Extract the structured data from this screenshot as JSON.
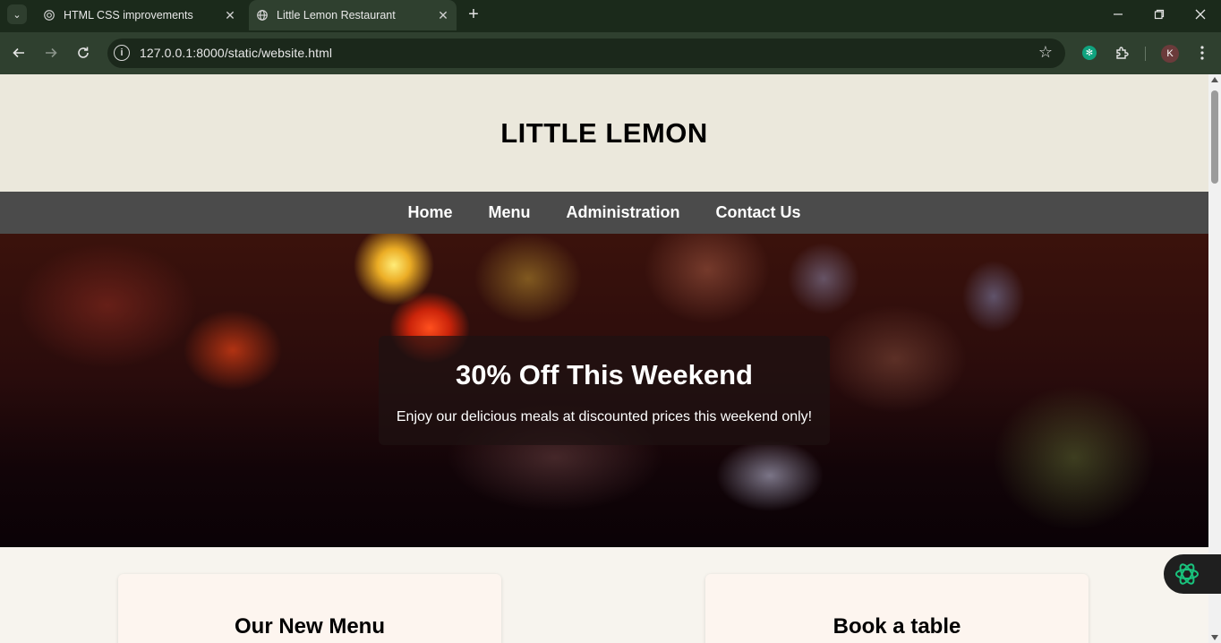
{
  "browser": {
    "tabs": [
      {
        "title": "HTML CSS improvements",
        "icon": "chatgpt-icon",
        "active": false
      },
      {
        "title": "Little Lemon Restaurant",
        "icon": "globe-icon",
        "active": true
      }
    ],
    "url": "127.0.0.1:8000/static/website.html",
    "profile_initial": "K",
    "colors": {
      "frame": "#1b2a1b",
      "toolbar": "#2f402f"
    }
  },
  "site": {
    "title": "LITTLE LEMON",
    "nav": [
      "Home",
      "Menu",
      "Administration",
      "Contact Us"
    ],
    "promo": {
      "heading": "30% Off This Weekend",
      "text": "Enjoy our delicious meals at discounted prices this weekend only!"
    },
    "cards": [
      "Our New Menu",
      "Book a table"
    ],
    "colors": {
      "header_bg": "#ebe8dc",
      "nav_bg": "#4b4b4b",
      "page_bg": "#f7f4ee",
      "card_bg": "#fdf5ef"
    }
  }
}
